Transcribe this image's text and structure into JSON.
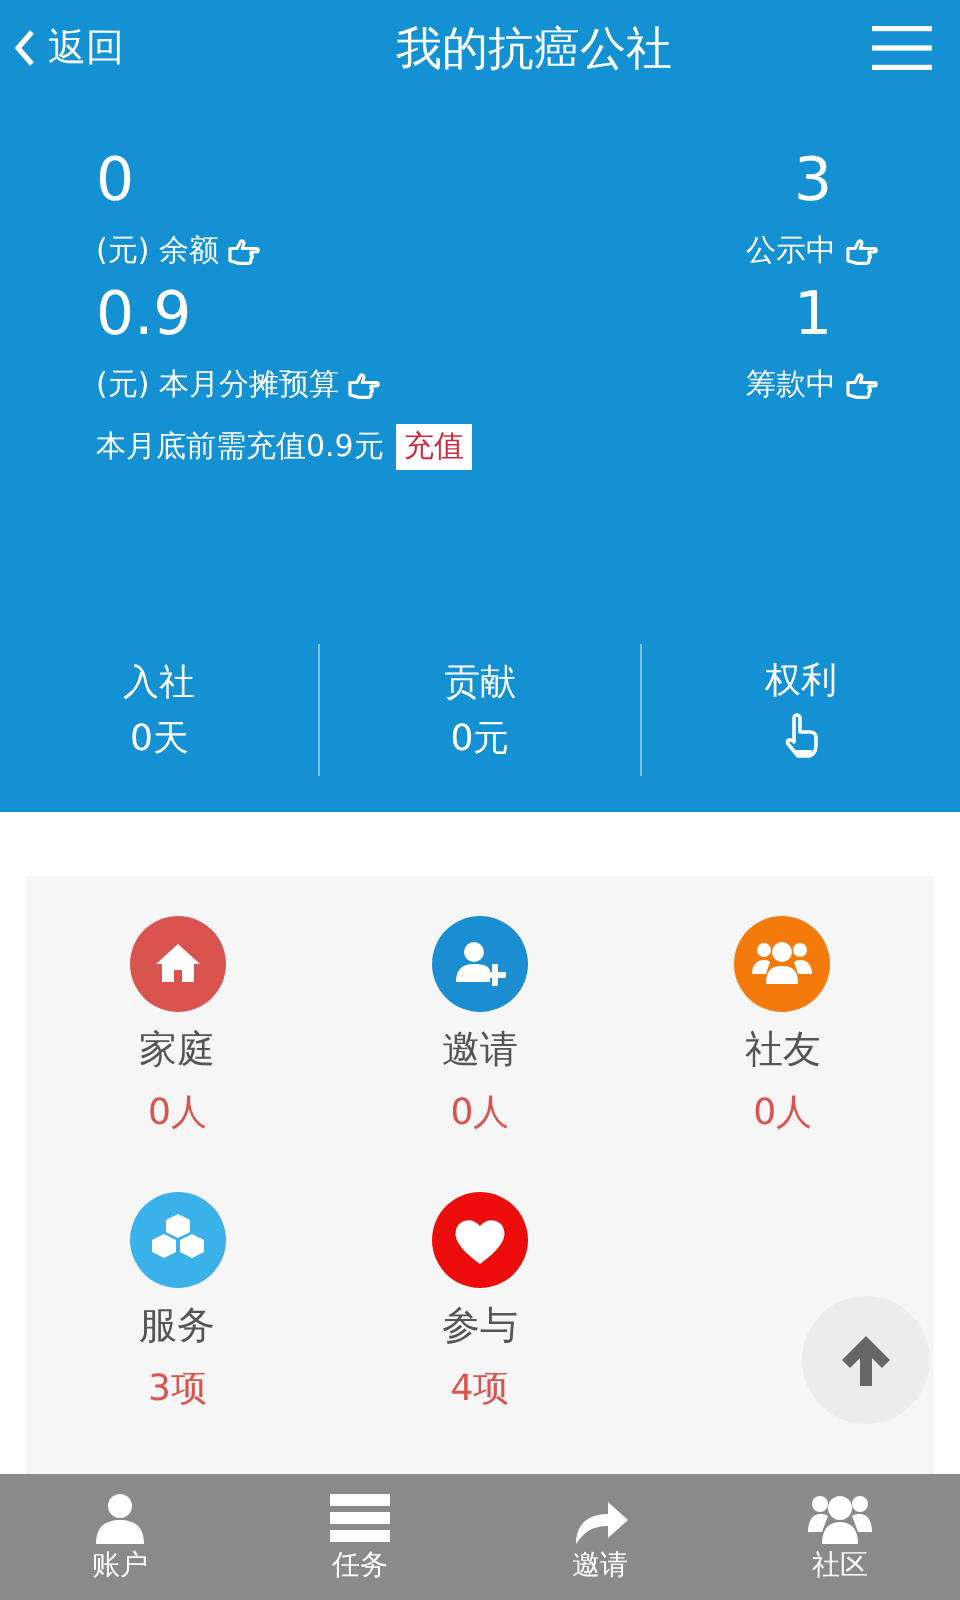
{
  "header": {
    "back": "返回",
    "title": "我的抗癌公社"
  },
  "stats": [
    {
      "value": "0",
      "label": "(元) 余额",
      "kind": "left"
    },
    {
      "value": "3",
      "label": "公示中",
      "kind": "right"
    },
    {
      "value": "0.9",
      "label": "(元) 本月分摊预算",
      "kind": "left"
    },
    {
      "value": "1",
      "label": "筹款中",
      "kind": "right"
    }
  ],
  "recharge": {
    "notice": "本月底前需充值0.9元",
    "button": "充值"
  },
  "summary": [
    {
      "label": "入社",
      "value": "0天",
      "kind": "text"
    },
    {
      "label": "贡献",
      "value": "0元",
      "kind": "text"
    },
    {
      "label": "权利",
      "kind": "hand"
    }
  ],
  "grid": [
    {
      "label": "家庭",
      "count": "0人",
      "kind": "home",
      "color": "#d9534f"
    },
    {
      "label": "邀请",
      "count": "0人",
      "kind": "invite",
      "color": "#1a8ed1"
    },
    {
      "label": "社友",
      "count": "0人",
      "kind": "group",
      "color": "#f57a0c"
    },
    {
      "label": "服务",
      "count": "3项",
      "kind": "cubes",
      "color": "#3bb1ea"
    },
    {
      "label": "参与",
      "count": "4项",
      "kind": "heart",
      "color": "#ec0c0c"
    }
  ],
  "tabs": [
    {
      "label": "账户",
      "kind": "user"
    },
    {
      "label": "任务",
      "kind": "list"
    },
    {
      "label": "邀请",
      "kind": "share"
    },
    {
      "label": "社区",
      "kind": "group"
    }
  ]
}
